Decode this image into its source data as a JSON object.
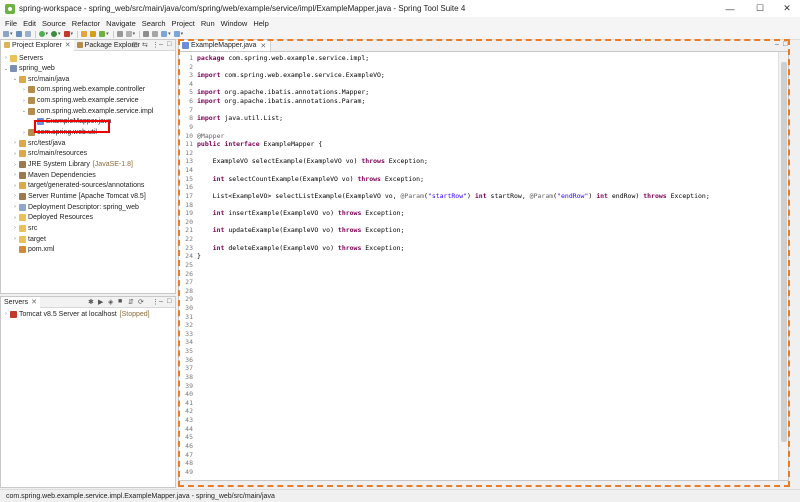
{
  "window": {
    "title": "spring-workspace - spring_web/src/main/java/com/spring/web/example/service/impl/ExampleMapper.java - Spring Tool Suite 4"
  },
  "menu": [
    "File",
    "Edit",
    "Source",
    "Refactor",
    "Navigate",
    "Search",
    "Project",
    "Run",
    "Window",
    "Help"
  ],
  "left_panel": {
    "tabs": [
      "Project Explorer",
      "Package Explorer"
    ],
    "tree": [
      {
        "label": "Servers",
        "icon": "folder-icon"
      },
      {
        "label": "spring_web",
        "icon": "project-icon"
      },
      {
        "label": "src/main/java",
        "icon": "source-folder-icon"
      },
      {
        "label": "com.spring.web.example.controller",
        "icon": "package-icon"
      },
      {
        "label": "com.spring.web.example.service",
        "icon": "package-icon"
      },
      {
        "label": "com.spring.web.example.service.impl",
        "icon": "package-icon"
      },
      {
        "label": "ExampleMapper.java",
        "icon": "java-file-icon"
      },
      {
        "label": "com.spring.web.util",
        "icon": "package-icon"
      },
      {
        "label": "src/test/java",
        "icon": "source-folder-icon"
      },
      {
        "label": "src/main/resources",
        "icon": "source-folder-icon"
      },
      {
        "label": "JRE System Library",
        "decoration": "[JavaSE-1.8]",
        "icon": "library-icon"
      },
      {
        "label": "Maven Dependencies",
        "icon": "library-icon"
      },
      {
        "label": "target/generated-sources/annotations",
        "icon": "source-folder-icon"
      },
      {
        "label": "Server Runtime [Apache Tomcat v8.5]",
        "icon": "library-icon"
      },
      {
        "label": "Deployment Descriptor: spring_web",
        "icon": "descriptor-icon"
      },
      {
        "label": "Deployed Resources",
        "icon": "folder-icon"
      },
      {
        "label": "src",
        "icon": "folder-icon"
      },
      {
        "label": "target",
        "icon": "folder-icon"
      },
      {
        "label": "pom.xml",
        "icon": "xml-file-icon"
      }
    ]
  },
  "servers_panel": {
    "tab": "Servers",
    "server": "Tomcat v8.5 Server at localhost",
    "state": "[Stopped]"
  },
  "editor": {
    "tab": "ExampleMapper.java",
    "line_count": 49,
    "lines": [
      "package com.spring.web.example.service.impl;",
      "",
      "import com.spring.web.example.service.ExampleVO;",
      "",
      "import org.apache.ibatis.annotations.Mapper;",
      "import org.apache.ibatis.annotations.Param;",
      "",
      "import java.util.List;",
      "",
      "@Mapper",
      "public interface ExampleMapper {",
      "",
      "    ExampleVO selectExample(ExampleVO vo) throws Exception;",
      "",
      "    int selectCountExample(ExampleVO vo) throws Exception;",
      "",
      "    List<ExampleVO> selectListExample(ExampleVO vo, @Param(\"startRow\") int startRow, @Param(\"endRow\") int endRow) throws Exception;",
      "",
      "    int insertExample(ExampleVO vo) throws Exception;",
      "",
      "    int updateExample(ExampleVO vo) throws Exception;",
      "",
      "    int deleteExample(ExampleVO vo) throws Exception;",
      "}"
    ]
  },
  "status": {
    "text": "com.spring.web.example.service.impl.ExampleMapper.java - spring_web/src/main/java"
  },
  "colors": {
    "highlight_red": "#e00000",
    "annotation_orange": "#e77c2b",
    "keyword": "#7f0055",
    "string": "#2a00ff"
  }
}
